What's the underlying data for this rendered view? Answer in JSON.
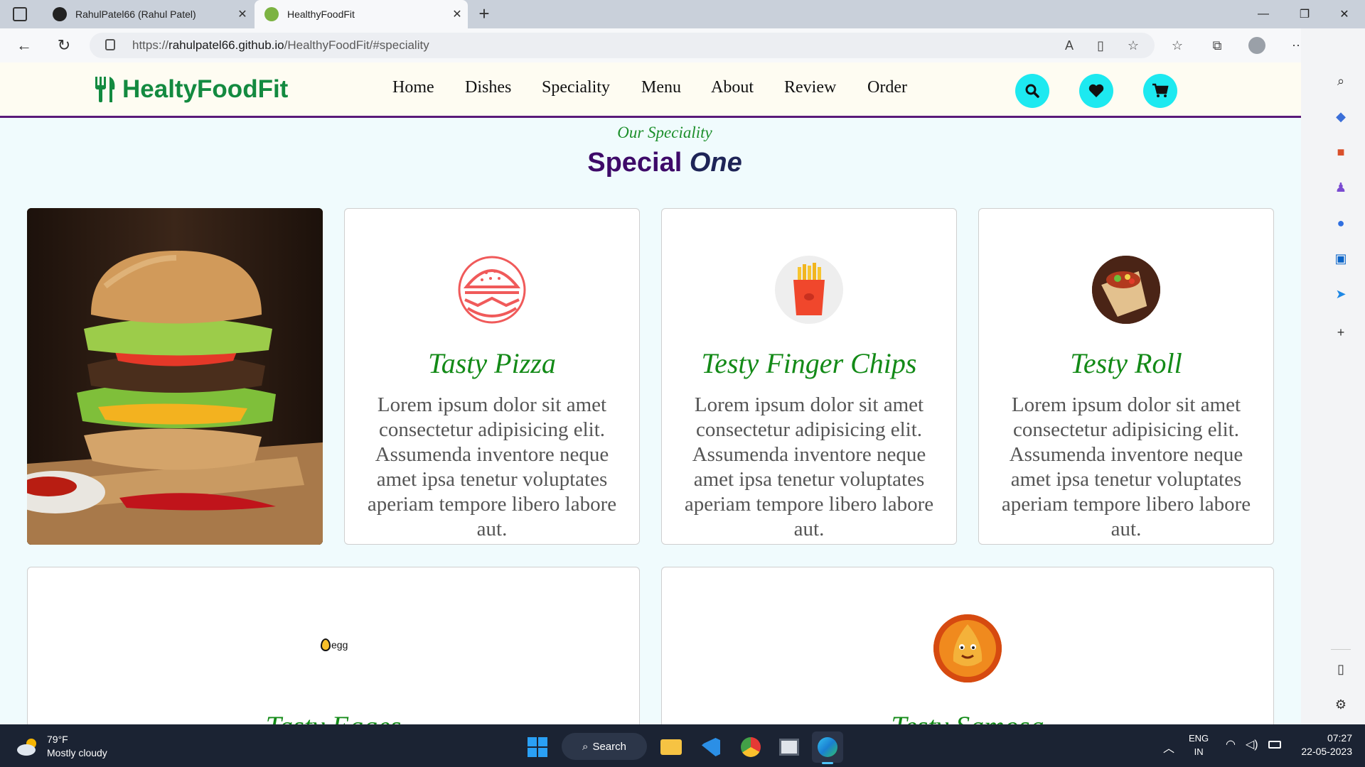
{
  "browser": {
    "tabs": [
      {
        "label": "RahulPatel66 (Rahul Patel)",
        "active": false
      },
      {
        "label": "HealthyFoodFit",
        "active": true
      }
    ],
    "new_tab_symbol": "+",
    "url_prefix": "https://",
    "url_host": "rahulpatel66.github.io",
    "url_path": "/HealthyFoodFit/#speciality"
  },
  "site": {
    "logo": "HealtyFoodFit",
    "nav": [
      "Home",
      "Dishes",
      "Speciality",
      "Menu",
      "About",
      "Review",
      "Order"
    ],
    "section_sub": "Our Speciality",
    "section_title_1": "Special ",
    "section_title_2": "One",
    "cards": [
      {
        "title": "Tasty Pizza",
        "text": "Lorem ipsum dolor sit amet consectetur adipisicing elit. Assumenda inventore neque amet ipsa tenetur voluptates aperiam tempore libero labore aut.",
        "icon": "burger-icon"
      },
      {
        "title": "Testy Finger Chips",
        "text": "Lorem ipsum dolor sit amet consectetur adipisicing elit. Assumenda inventore neque amet ipsa tenetur voluptates aperiam tempore libero labore aut.",
        "icon": "fries-icon"
      },
      {
        "title": "Testy Roll",
        "text": "Lorem ipsum dolor sit amet consectetur adipisicing elit. Assumenda inventore neque amet ipsa tenetur voluptates aperiam tempore libero labore aut.",
        "icon": "wrap-icon"
      },
      {
        "title": "Tasty Egges",
        "icon_text": "egg",
        "icon": "egg-icon"
      },
      {
        "title": "Testy Samosa",
        "icon": "samosa-icon"
      }
    ]
  },
  "taskbar": {
    "weather_temp": "79°F",
    "weather_desc": "Mostly cloudy",
    "search_label": "Search",
    "lang_1": "ENG",
    "lang_2": "IN",
    "time": "07:27",
    "date": "22-05-2023"
  },
  "colors": {
    "brand_green": "#138a40",
    "accent_cyan": "#1de9f0",
    "title_purple": "#3e0a69",
    "card_title_green": "#138a17"
  }
}
